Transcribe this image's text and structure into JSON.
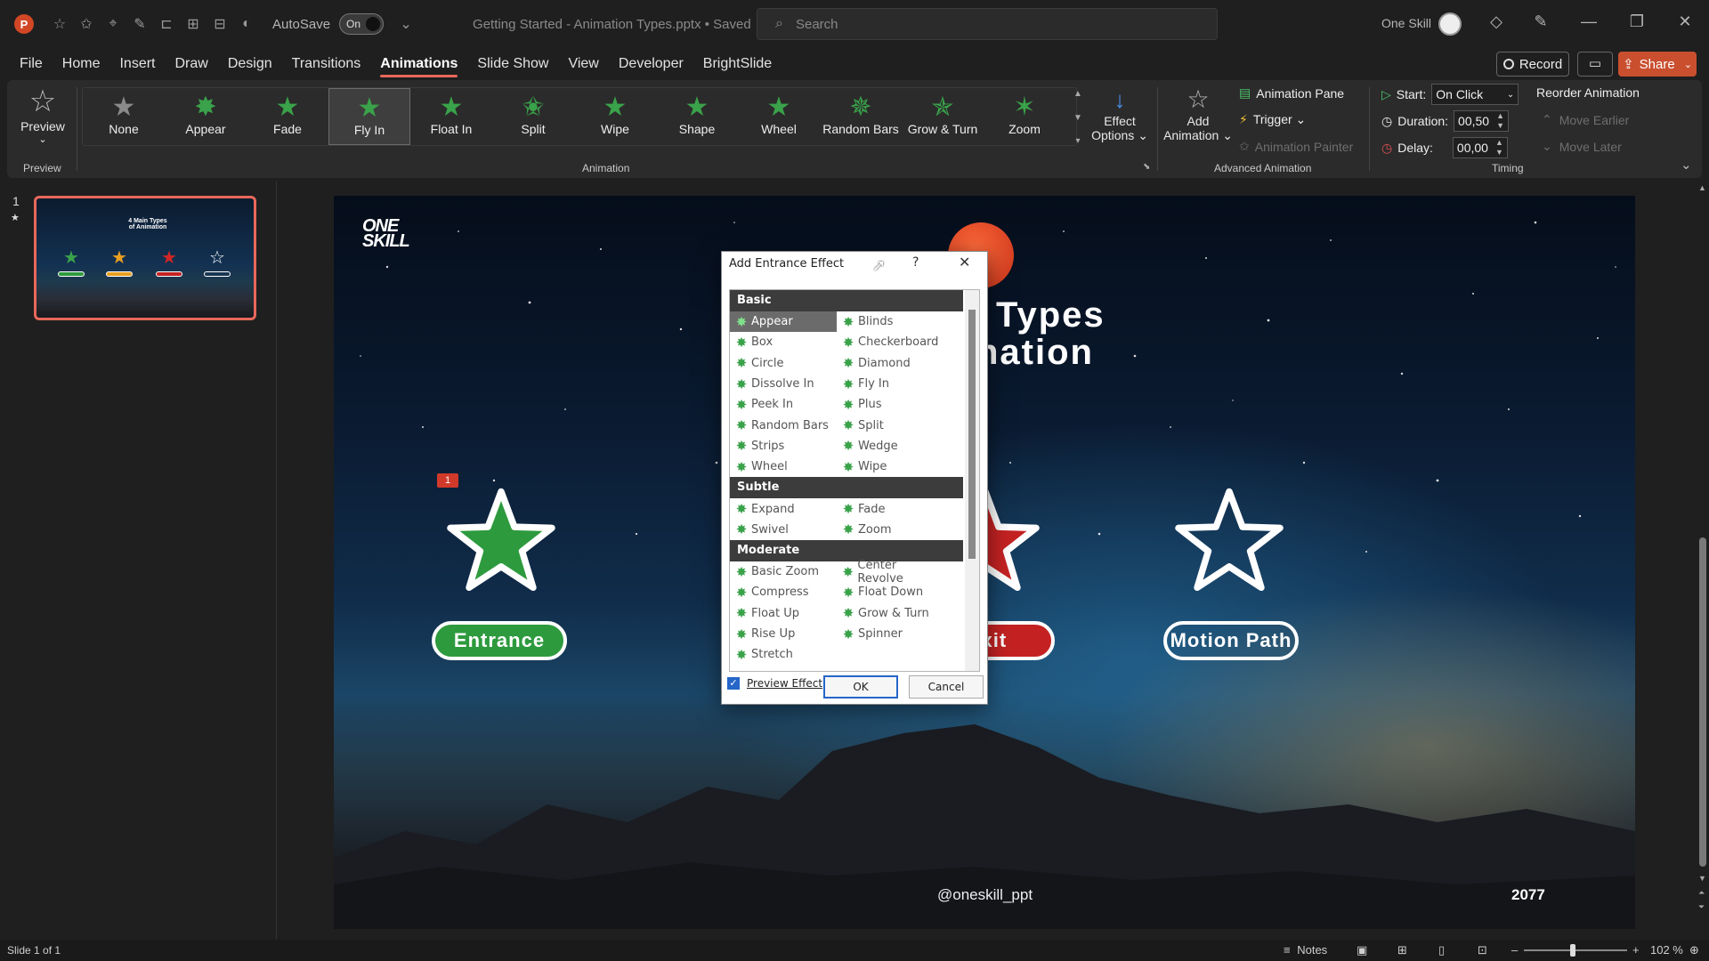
{
  "titlebar": {
    "autosave_label": "AutoSave",
    "autosave_state": "On",
    "doc_title": "Getting Started - Animation Types.pptx • Saved ⌄",
    "search_placeholder": "Search",
    "user_name": "One Skill"
  },
  "menu": {
    "tabs": [
      "File",
      "Home",
      "Insert",
      "Draw",
      "Design",
      "Transitions",
      "Animations",
      "Slide Show",
      "View",
      "Developer",
      "BrightSlide"
    ],
    "active_tab": "Animations",
    "record_label": "Record",
    "share_label": "Share"
  },
  "ribbon": {
    "preview_label": "Preview",
    "preview_group": "Preview",
    "animation_group": "Animation",
    "effects": [
      {
        "label": "None",
        "selected": false
      },
      {
        "label": "Appear",
        "selected": false
      },
      {
        "label": "Fade",
        "selected": false
      },
      {
        "label": "Fly In",
        "selected": true
      },
      {
        "label": "Float In",
        "selected": false
      },
      {
        "label": "Split",
        "selected": false
      },
      {
        "label": "Wipe",
        "selected": false
      },
      {
        "label": "Shape",
        "selected": false
      },
      {
        "label": "Wheel",
        "selected": false
      },
      {
        "label": "Random Bars",
        "selected": false
      },
      {
        "label": "Grow & Turn",
        "selected": false
      },
      {
        "label": "Zoom",
        "selected": false
      }
    ],
    "effect_options_1": "Effect",
    "effect_options_2": "Options ⌄",
    "add_animation_1": "Add",
    "add_animation_2": "Animation ⌄",
    "animation_pane": "Animation Pane",
    "trigger": "Trigger ⌄",
    "animation_painter": "Animation Painter",
    "advanced_group": "Advanced Animation",
    "start_label": "Start:",
    "start_value": "On Click",
    "duration_label": "Duration:",
    "duration_value": "00,50",
    "delay_label": "Delay:",
    "delay_value": "00,00",
    "reorder_label": "Reorder Animation",
    "move_earlier": "Move Earlier",
    "move_later": "Move Later",
    "timing_group": "Timing"
  },
  "thumbs": {
    "slide_number": "1",
    "thumb_title": "4 Main Types\nof Animation"
  },
  "slide": {
    "logo_line1": "ONE",
    "logo_line2": "SKILL",
    "title_line1": "Types",
    "title_line2": "nation",
    "anim_badge": "1",
    "items": [
      {
        "label": "Entrance",
        "color": "#2e9a3e"
      },
      {
        "label": "Exit",
        "color": "#c42222"
      },
      {
        "label": "Motion Path",
        "color": "transparent"
      }
    ],
    "handle": "@oneskill_ppt",
    "year": "2077"
  },
  "dialog": {
    "title": "Add Entrance Effect",
    "help": "?",
    "close": "✕",
    "categories": [
      {
        "name": "Basic",
        "rows": [
          [
            "Appear",
            "Blinds"
          ],
          [
            "Box",
            "Checkerboard"
          ],
          [
            "Circle",
            "Diamond"
          ],
          [
            "Dissolve In",
            "Fly In"
          ],
          [
            "Peek In",
            "Plus"
          ],
          [
            "Random Bars",
            "Split"
          ],
          [
            "Strips",
            "Wedge"
          ],
          [
            "Wheel",
            "Wipe"
          ]
        ]
      },
      {
        "name": "Subtle",
        "rows": [
          [
            "Expand",
            "Fade"
          ],
          [
            "Swivel",
            "Zoom"
          ]
        ]
      },
      {
        "name": "Moderate",
        "rows": [
          [
            "Basic Zoom",
            "Center Revolve"
          ],
          [
            "Compress",
            "Float Down"
          ],
          [
            "Float Up",
            "Grow & Turn"
          ],
          [
            "Rise Up",
            "Spinner"
          ],
          [
            "Stretch",
            ""
          ]
        ]
      }
    ],
    "selected_item": "Appear",
    "preview_effect_label": "Preview Effect",
    "ok_label": "OK",
    "cancel_label": "Cancel"
  },
  "statusbar": {
    "slide_info": "Slide 1 of 1",
    "notes_label": "Notes",
    "zoom": "102 %"
  }
}
